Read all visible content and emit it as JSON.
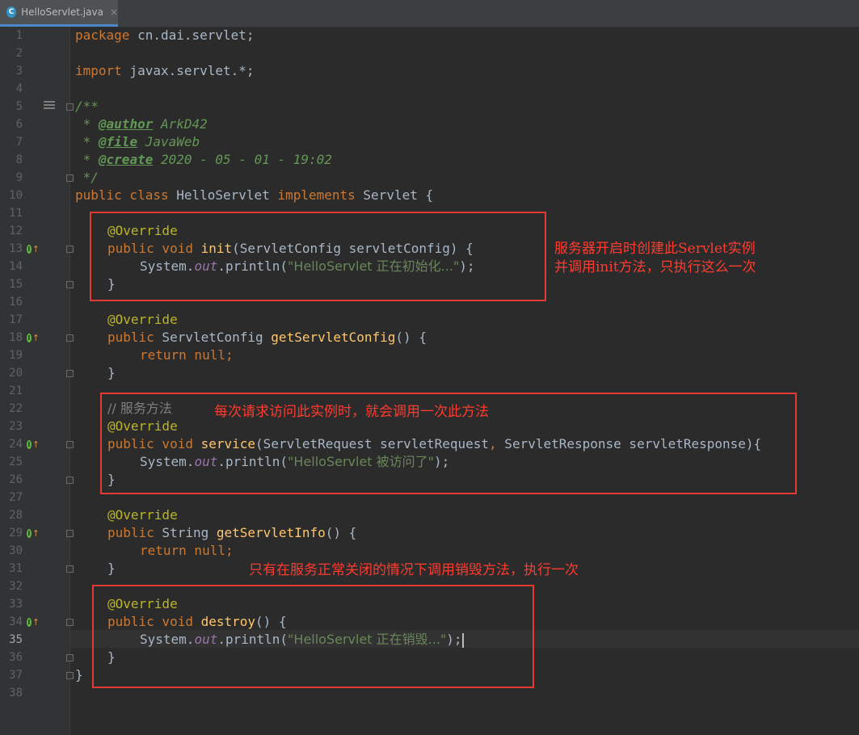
{
  "tab": {
    "icon": "C",
    "title": "HelloServlet.java",
    "close": "×"
  },
  "current_line": 35,
  "lines": [
    "1",
    "2",
    "3",
    "4",
    "5",
    "6",
    "7",
    "8",
    "9",
    "10",
    "11",
    "12",
    "13",
    "14",
    "15",
    "16",
    "17",
    "18",
    "19",
    "20",
    "21",
    "22",
    "23",
    "24",
    "25",
    "26",
    "27",
    "28",
    "29",
    "30",
    "31",
    "32",
    "33",
    "34",
    "35",
    "36",
    "37",
    "38"
  ],
  "code": {
    "l1": {
      "kw": "package",
      "rest": " cn.dai.servlet;"
    },
    "l3": {
      "kw": "import",
      "rest": " javax.servlet.*;"
    },
    "l5": "/**",
    "l6": {
      "pre": " * ",
      "tag": "@author",
      "val": " ArkD42"
    },
    "l7": {
      "pre": " * ",
      "tag": "@file",
      "val": " JavaWeb"
    },
    "l8": {
      "pre": " * ",
      "tag": "@create",
      "val": " 2020 - 05 - 01 - 19:02"
    },
    "l9": " */",
    "l10": {
      "kw": "public class",
      "name": " HelloServlet ",
      "kw2": "implements",
      "rest": " Servlet {"
    },
    "l12": "@Override",
    "l13": {
      "kw": "public void",
      "fn": "init",
      "rest": "(ServletConfig servletConfig) {"
    },
    "l14": {
      "a": "System.",
      "b": "out",
      "c": ".println(",
      "str": "\"HelloServlet 正在初始化...\"",
      "d": ");"
    },
    "l15": "}",
    "l17": "@Override",
    "l18": {
      "kw": "public",
      "type": " ServletConfig ",
      "fn": "getServletConfig",
      "rest": "() {"
    },
    "l19": {
      "kw": "return null;"
    },
    "l20": "}",
    "l22": "// 服务方法",
    "l23": "@Override",
    "l24": {
      "kw": "public void",
      "fn": "service",
      "rest": "(ServletRequest servletRequest",
      "kw2": ",",
      "rest2": " ServletResponse servletResponse){"
    },
    "l25": {
      "a": "System.",
      "b": "out",
      "c": ".println(",
      "str": "\"HelloServlet 被访问了\"",
      "d": ");"
    },
    "l26": "}",
    "l28": "@Override",
    "l29": {
      "kw": "public",
      "type": " String ",
      "fn": "getServletInfo",
      "rest": "() {"
    },
    "l30": {
      "kw": "return null;"
    },
    "l31": "}",
    "l33": "@Override",
    "l34": {
      "kw": "public void",
      "fn": "destroy",
      "rest": "() {"
    },
    "l35": {
      "a": "System.",
      "b": "out",
      "c": ".println(",
      "str": "\"HelloServlet 正在销毁...\"",
      "d": ");"
    },
    "l36": "}",
    "l37": "}"
  },
  "annotations": {
    "init_note_1": "服务器开启时创建此Servlet实例",
    "init_note_2": "并调用init方法，只执行这么一次",
    "service_note": "每次请求访问此实例时，就会调用一次此方法",
    "destroy_note": "只有在服务正常关闭的情况下调用销毁方法，执行一次"
  },
  "colors": {
    "box": "#e53935",
    "note": "#ff3b30"
  }
}
